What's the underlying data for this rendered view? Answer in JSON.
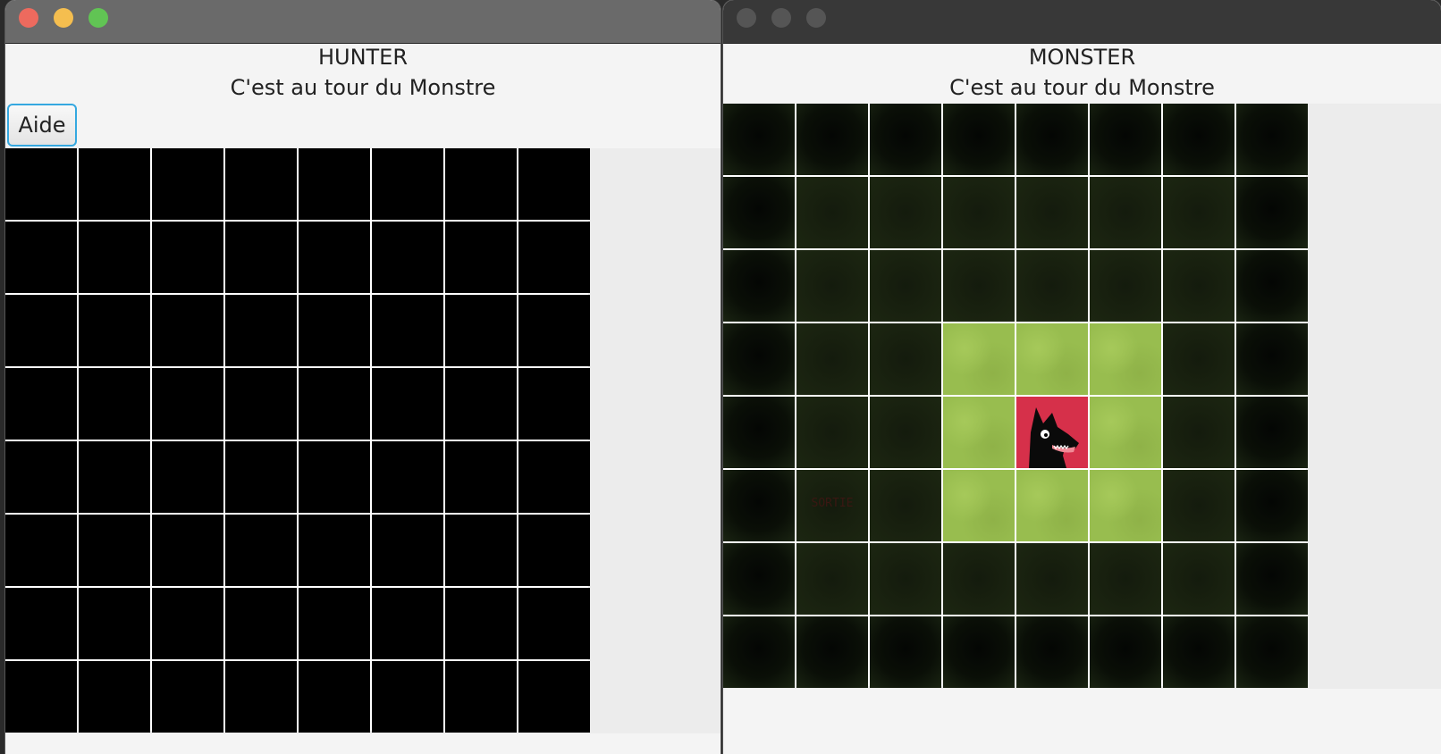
{
  "hunter_window": {
    "title": "HUNTER",
    "status": "C'est au tour du Monstre",
    "help_button": "Aide",
    "grid": {
      "rows": 8,
      "cols": 8
    }
  },
  "monster_window": {
    "title": "MONSTER",
    "status": "C'est au tour du Monstre",
    "exit_label": "SORTIE",
    "grid": {
      "rows": 8,
      "cols": 8,
      "monster_cell": [
        4,
        4
      ],
      "exit_cell": [
        5,
        1
      ],
      "revealed_grass": [
        [
          3,
          3
        ],
        [
          3,
          4
        ],
        [
          3,
          5
        ],
        [
          4,
          3
        ],
        [
          4,
          5
        ],
        [
          5,
          3
        ],
        [
          5,
          4
        ],
        [
          5,
          5
        ]
      ]
    }
  },
  "colors": {
    "close": "#ed6a5e",
    "minimize": "#f5be4f",
    "zoom": "#61c454",
    "inactive_light": "#555555",
    "monster_bg": "#d6304a",
    "grass": "#98bd4f",
    "grid_line": "#ffffff"
  },
  "icons": [
    "monster-wolf-icon"
  ]
}
